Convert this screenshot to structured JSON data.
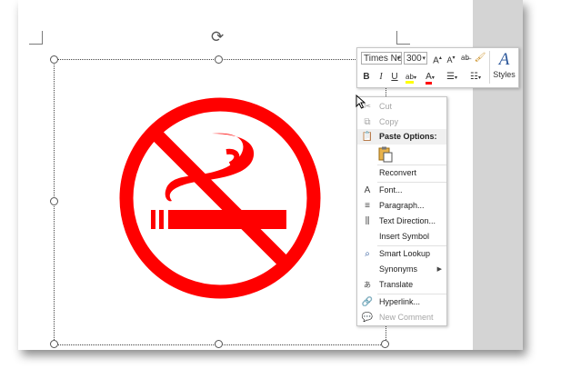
{
  "toolbar": {
    "font_name": "Times Ne",
    "font_size": "300",
    "grow_font": "A",
    "shrink_font": "A",
    "bold": "B",
    "italic": "I",
    "underline": "U",
    "font_color_label": "A",
    "styles_label": "Styles",
    "styles_icon_letter": "A"
  },
  "context_menu": {
    "items": [
      {
        "label": "Cut",
        "icon": "scissors-icon",
        "enabled": false
      },
      {
        "label": "Copy",
        "icon": "copy-icon",
        "enabled": false
      },
      {
        "label": "Paste Options:",
        "icon": "clipboard-icon",
        "enabled": true
      },
      {
        "label": "Reconvert",
        "icon": "",
        "enabled": true
      },
      {
        "label": "Font...",
        "icon": "font-icon",
        "enabled": true
      },
      {
        "label": "Paragraph...",
        "icon": "paragraph-icon",
        "enabled": true
      },
      {
        "label": "Text Direction...",
        "icon": "text-direction-icon",
        "enabled": true
      },
      {
        "label": "Insert Symbol",
        "icon": "",
        "enabled": true
      },
      {
        "label": "Smart Lookup",
        "icon": "search-icon",
        "enabled": true
      },
      {
        "label": "Synonyms",
        "icon": "",
        "enabled": true,
        "submenu": true
      },
      {
        "label": "Translate",
        "icon": "translate-icon",
        "enabled": true
      },
      {
        "label": "Hyperlink...",
        "icon": "hyperlink-icon",
        "enabled": true
      },
      {
        "label": "New Comment",
        "icon": "comment-icon",
        "enabled": false
      }
    ]
  },
  "picture": {
    "icon": "no-smoking-icon",
    "color": "#ff0000"
  },
  "colors": {
    "accent": "#2b579a",
    "sign_red": "#ff0000",
    "highlight": "#ffff00",
    "font_red": "#ff0000"
  }
}
